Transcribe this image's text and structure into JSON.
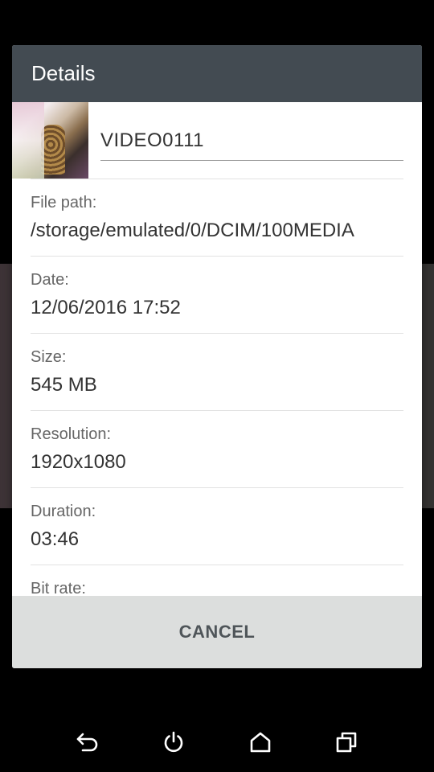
{
  "dialog": {
    "title": "Details",
    "file_name": "VIDEO0111",
    "details": [
      {
        "label": "File path:",
        "value": "/storage/emulated/0/DCIM/100MEDIA"
      },
      {
        "label": "Date:",
        "value": "12/06/2016 17:52"
      },
      {
        "label": "Size:",
        "value": "545 MB"
      },
      {
        "label": "Resolution:",
        "value": "1920x1080"
      },
      {
        "label": "Duration:",
        "value": "03:46"
      },
      {
        "label": "Bit rate:",
        "value": ""
      }
    ],
    "cancel_label": "CANCEL"
  },
  "nav": {
    "icons": [
      "back-icon",
      "power-icon",
      "home-icon",
      "recents-icon"
    ]
  },
  "colors": {
    "header_bg": "#434b52",
    "footer_bg": "#dcdedd",
    "nav_icon": "#ffffff"
  }
}
